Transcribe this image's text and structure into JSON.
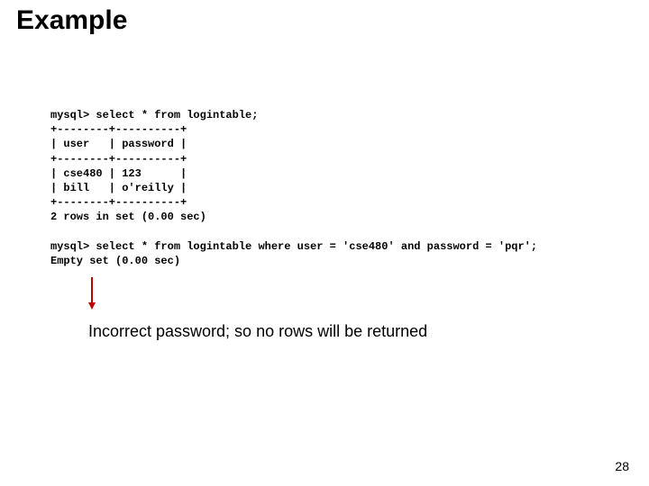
{
  "title": "Example",
  "code": "mysql> select * from logintable;\n+--------+----------+\n| user   | password |\n+--------+----------+\n| cse480 | 123      |\n| bill   | o'reilly |\n+--------+----------+\n2 rows in set (0.00 sec)\n\nmysql> select * from logintable where user = 'cse480' and password = 'pqr';\nEmpty set (0.00 sec)",
  "caption": "Incorrect password; so no rows will be returned",
  "page_number": "28"
}
